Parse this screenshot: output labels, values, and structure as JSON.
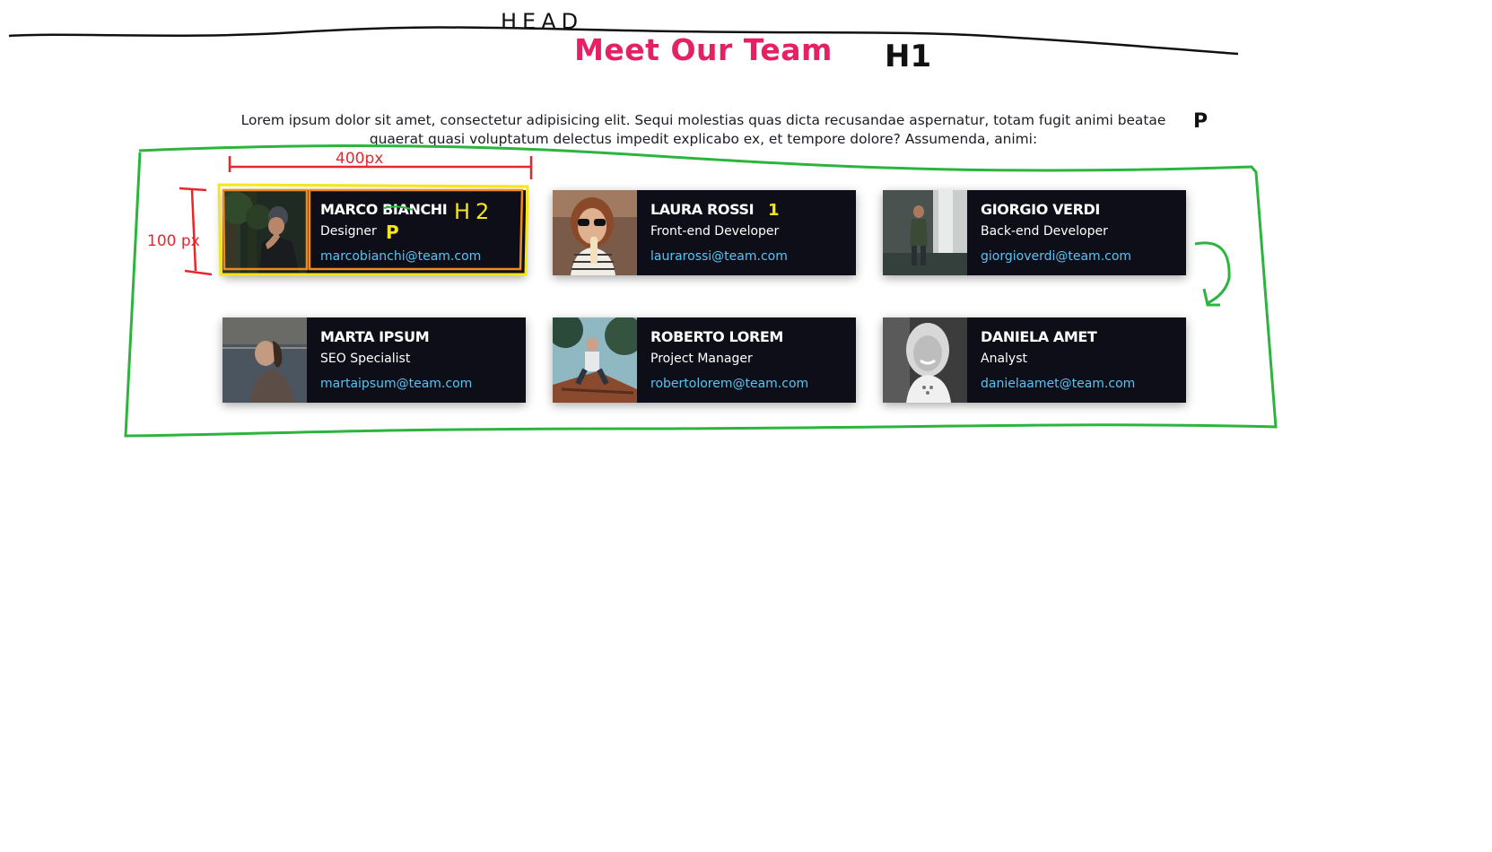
{
  "header": {
    "title": "Meet Our Team",
    "intro": "Lorem ipsum dolor sit amet, consectetur adipisicing elit. Sequi molestias quas dicta recusandae aspernatur, totam fugit animi beatae quaerat quasi voluptatum delectus impedit explicabo ex, et tempore dolore? Assumenda, animi:"
  },
  "team": [
    {
      "name": "MARCO BIANCHI",
      "role": "Designer",
      "email": "marcobianchi@team.com",
      "photo": "man-in-beanie-forest"
    },
    {
      "name": "LAURA ROSSI",
      "role": "Front-end Developer",
      "email": "laurarossi@team.com",
      "photo": "woman-sunglasses-drink"
    },
    {
      "name": "GIORGIO VERDI",
      "role": "Back-end Developer",
      "email": "giorgioverdi@team.com",
      "photo": "man-by-waterfall"
    },
    {
      "name": "MARTA IPSUM",
      "role": "SEO Specialist",
      "email": "martaipsum@team.com",
      "photo": "woman-by-lake-sunset"
    },
    {
      "name": "ROBERTO LOREM",
      "role": "Project Manager",
      "email": "robertolorem@team.com",
      "photo": "man-on-roof-trees"
    },
    {
      "name": "DANIELA AMET",
      "role": "Analyst",
      "email": "danielaamet@team.com",
      "photo": "smiling-woman-bw"
    }
  ],
  "annotations": {
    "head_label": "HEAD",
    "h1_label": "H1",
    "p_label": "P",
    "h2_label": "H2",
    "card_p_label": "P",
    "width_label": "400px",
    "height_label": "100 px",
    "tick_mark": "1"
  },
  "colors": {
    "title": "#e62163",
    "card_bg": "#0e0e19",
    "email": "#58c4f2",
    "marker_green": "#2bb43e",
    "marker_red": "#e8262e",
    "marker_yellow": "#f5e617",
    "marker_orange": "#f08a1c"
  }
}
